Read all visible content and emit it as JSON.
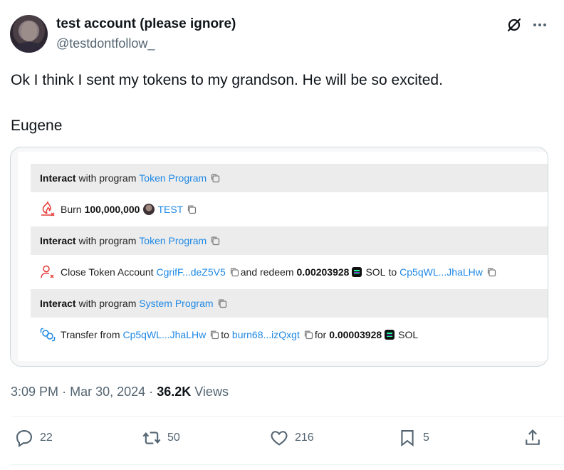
{
  "author": {
    "name": "test account (please ignore)",
    "handle": "@testdontfollow_"
  },
  "tweet": {
    "line1": "Ok I think I sent my tokens to my grandson. He will be so excited.",
    "line2": "Eugene"
  },
  "transaction": {
    "ix1": {
      "bold": "Interact",
      "text": " with program ",
      "program": "Token Program"
    },
    "burn": {
      "verb": "Burn",
      "amount": "100,000,000",
      "token": "TEST"
    },
    "ix2": {
      "bold": "Interact",
      "text": " with program ",
      "program": "Token Program"
    },
    "close": {
      "verb": "Close Token Account",
      "account": "CgrifF...deZ5V5",
      "redeem": "and redeem",
      "amount": "0.00203928",
      "token": "SOL",
      "to": "to",
      "dest": "Cp5qWL...JhaLHw"
    },
    "ix3": {
      "bold": "Interact",
      "text": " with program ",
      "program": "System Program"
    },
    "transfer": {
      "verb": "Transfer from",
      "from": "Cp5qWL...JhaLHw",
      "to": "to",
      "dest": "burn68...izQxgt",
      "for": "for",
      "amount": "0.00003928",
      "token": "SOL"
    }
  },
  "meta": {
    "time": "3:09 PM",
    "date": "Mar 30, 2024",
    "views_count": "36.2K",
    "views_label": "Views"
  },
  "stats": {
    "replies": "22",
    "reposts": "50",
    "likes": "216",
    "bookmarks": "5"
  },
  "colors": {
    "link": "#1e88e5",
    "muted": "#536471",
    "text": "#0f1419"
  }
}
